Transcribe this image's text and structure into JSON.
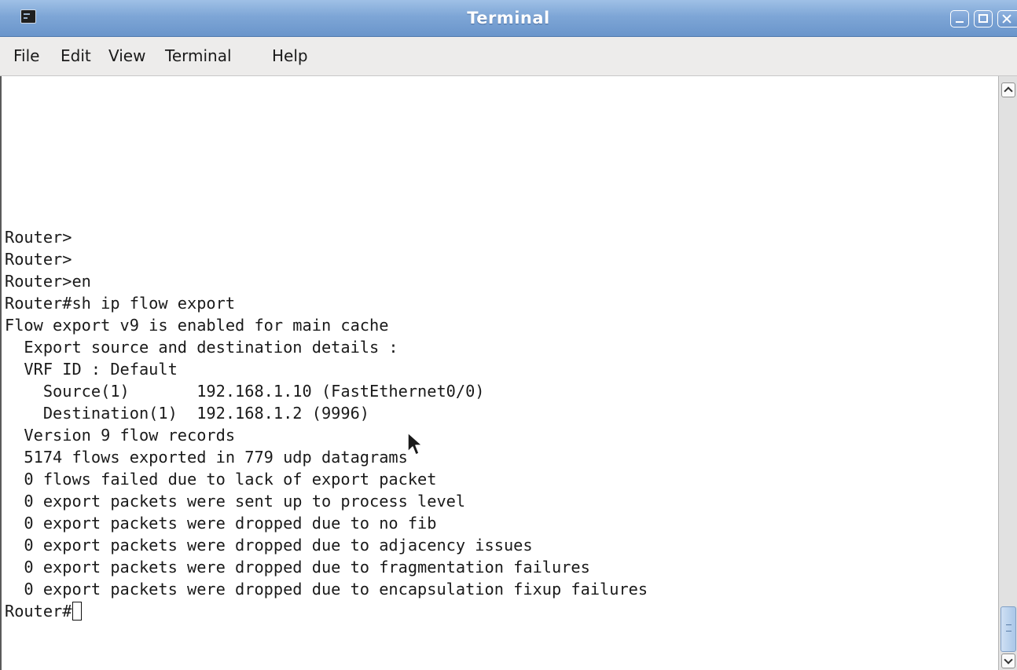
{
  "window": {
    "title": "Terminal"
  },
  "menu": {
    "file": "File",
    "edit": "Edit",
    "view": "View",
    "terminal": "Terminal",
    "help": "Help"
  },
  "terminal": {
    "lines": [
      "Router>",
      "Router>",
      "Router>en",
      "Router#sh ip flow export",
      "Flow export v9 is enabled for main cache",
      "  Export source and destination details :",
      "  VRF ID : Default",
      "    Source(1)       192.168.1.10 (FastEthernet0/0)",
      "    Destination(1)  192.168.1.2 (9996)",
      "  Version 9 flow records",
      "  5174 flows exported in 779 udp datagrams",
      "  0 flows failed due to lack of export packet",
      "  0 export packets were sent up to process level",
      "  0 export packets were dropped due to no fib",
      "  0 export packets were dropped due to adjacency issues",
      "  0 export packets were dropped due to fragmentation failures",
      "  0 export packets were dropped due to encapsulation fixup failures"
    ],
    "prompt": "Router#"
  },
  "icons": {
    "app": "terminal-icon",
    "minimize": "minimize-icon",
    "maximize": "maximize-icon",
    "close": "close-icon",
    "scroll_up": "scroll-up-arrow-icon",
    "scroll_down": "scroll-down-arrow-icon",
    "pointer": "mouse-pointer-icon"
  },
  "colors": {
    "titlebar": "#7ea6d6",
    "menubar": "#edeceb",
    "terminal_bg": "#ffffff",
    "terminal_fg": "#1a1a1a"
  }
}
